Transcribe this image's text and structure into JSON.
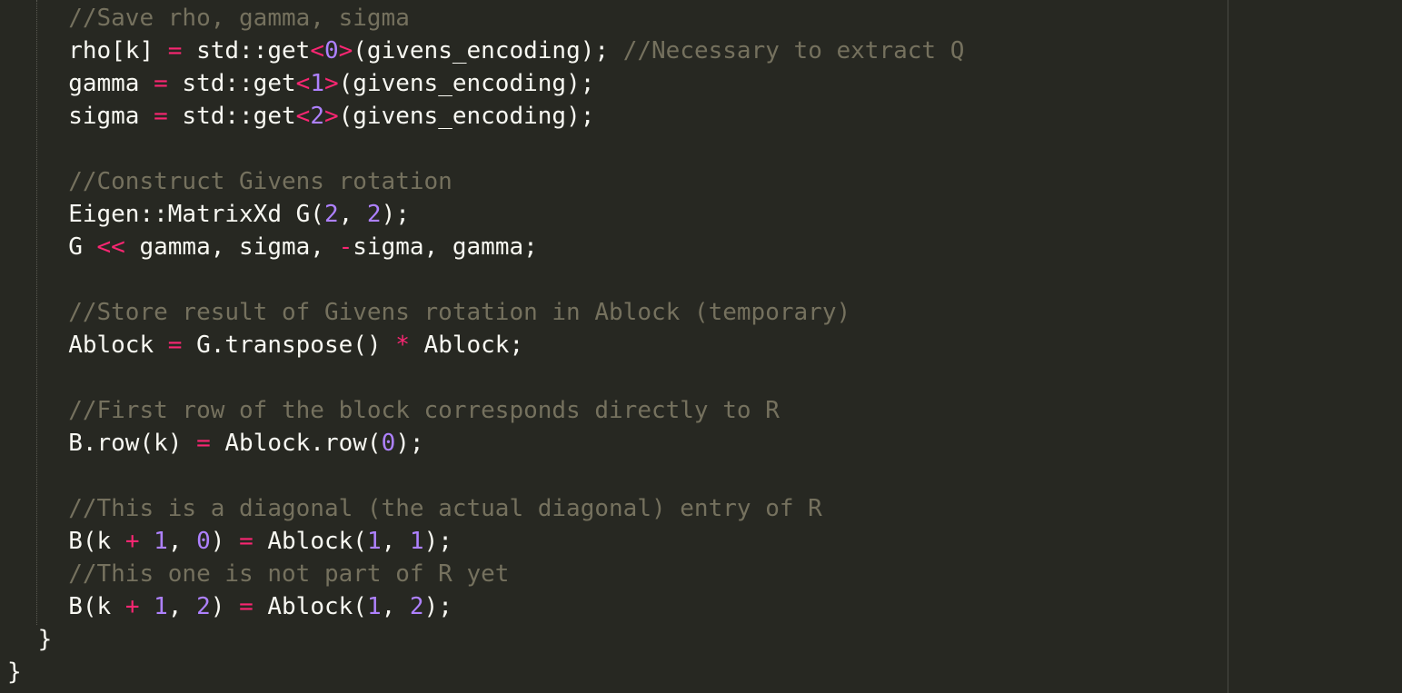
{
  "editor": {
    "colors": {
      "background": "#272822",
      "plain": "#F8F8F2",
      "operator": "#F92672",
      "number": "#AE81FF",
      "comment": "#75715E"
    },
    "lines": [
      {
        "indent": 4,
        "tokens": [
          {
            "k": "com",
            "t": "//Save rho, gamma, sigma"
          }
        ]
      },
      {
        "indent": 4,
        "tokens": [
          {
            "k": "plain",
            "t": "rho[k] "
          },
          {
            "k": "op",
            "t": "="
          },
          {
            "k": "plain",
            "t": " std::get"
          },
          {
            "k": "op",
            "t": "<"
          },
          {
            "k": "num",
            "t": "0"
          },
          {
            "k": "op",
            "t": ">"
          },
          {
            "k": "plain",
            "t": "(givens_encoding); "
          },
          {
            "k": "com",
            "t": "//Necessary to extract Q"
          }
        ]
      },
      {
        "indent": 4,
        "tokens": [
          {
            "k": "plain",
            "t": "gamma "
          },
          {
            "k": "op",
            "t": "="
          },
          {
            "k": "plain",
            "t": " std::get"
          },
          {
            "k": "op",
            "t": "<"
          },
          {
            "k": "num",
            "t": "1"
          },
          {
            "k": "op",
            "t": ">"
          },
          {
            "k": "plain",
            "t": "(givens_encoding);"
          }
        ]
      },
      {
        "indent": 4,
        "tokens": [
          {
            "k": "plain",
            "t": "sigma "
          },
          {
            "k": "op",
            "t": "="
          },
          {
            "k": "plain",
            "t": " std::get"
          },
          {
            "k": "op",
            "t": "<"
          },
          {
            "k": "num",
            "t": "2"
          },
          {
            "k": "op",
            "t": ">"
          },
          {
            "k": "plain",
            "t": "(givens_encoding);"
          }
        ]
      },
      {
        "indent": 0,
        "tokens": []
      },
      {
        "indent": 4,
        "tokens": [
          {
            "k": "com",
            "t": "//Construct Givens rotation"
          }
        ]
      },
      {
        "indent": 4,
        "tokens": [
          {
            "k": "plain",
            "t": "Eigen::MatrixXd G("
          },
          {
            "k": "num",
            "t": "2"
          },
          {
            "k": "plain",
            "t": ", "
          },
          {
            "k": "num",
            "t": "2"
          },
          {
            "k": "plain",
            "t": ");"
          }
        ]
      },
      {
        "indent": 4,
        "tokens": [
          {
            "k": "plain",
            "t": "G "
          },
          {
            "k": "op",
            "t": "<<"
          },
          {
            "k": "plain",
            "t": " gamma, sigma, "
          },
          {
            "k": "op",
            "t": "-"
          },
          {
            "k": "plain",
            "t": "sigma, gamma;"
          }
        ]
      },
      {
        "indent": 0,
        "tokens": []
      },
      {
        "indent": 4,
        "tokens": [
          {
            "k": "com",
            "t": "//Store result of Givens rotation in Ablock (temporary)"
          }
        ]
      },
      {
        "indent": 4,
        "tokens": [
          {
            "k": "plain",
            "t": "Ablock "
          },
          {
            "k": "op",
            "t": "="
          },
          {
            "k": "plain",
            "t": " G.transpose() "
          },
          {
            "k": "op",
            "t": "*"
          },
          {
            "k": "plain",
            "t": " Ablock;"
          }
        ]
      },
      {
        "indent": 0,
        "tokens": []
      },
      {
        "indent": 4,
        "tokens": [
          {
            "k": "com",
            "t": "//First row of the block corresponds directly to R"
          }
        ]
      },
      {
        "indent": 4,
        "tokens": [
          {
            "k": "plain",
            "t": "B.row(k) "
          },
          {
            "k": "op",
            "t": "="
          },
          {
            "k": "plain",
            "t": " Ablock.row("
          },
          {
            "k": "num",
            "t": "0"
          },
          {
            "k": "plain",
            "t": ");"
          }
        ]
      },
      {
        "indent": 0,
        "tokens": []
      },
      {
        "indent": 4,
        "tokens": [
          {
            "k": "com",
            "t": "//This is a diagonal (the actual diagonal) entry of R"
          }
        ]
      },
      {
        "indent": 4,
        "tokens": [
          {
            "k": "plain",
            "t": "B(k "
          },
          {
            "k": "op",
            "t": "+"
          },
          {
            "k": "plain",
            "t": " "
          },
          {
            "k": "num",
            "t": "1"
          },
          {
            "k": "plain",
            "t": ", "
          },
          {
            "k": "num",
            "t": "0"
          },
          {
            "k": "plain",
            "t": ") "
          },
          {
            "k": "op",
            "t": "="
          },
          {
            "k": "plain",
            "t": " Ablock("
          },
          {
            "k": "num",
            "t": "1"
          },
          {
            "k": "plain",
            "t": ", "
          },
          {
            "k": "num",
            "t": "1"
          },
          {
            "k": "plain",
            "t": ");"
          }
        ]
      },
      {
        "indent": 4,
        "tokens": [
          {
            "k": "com",
            "t": "//This one is not part of R yet"
          }
        ]
      },
      {
        "indent": 4,
        "tokens": [
          {
            "k": "plain",
            "t": "B(k "
          },
          {
            "k": "op",
            "t": "+"
          },
          {
            "k": "plain",
            "t": " "
          },
          {
            "k": "num",
            "t": "1"
          },
          {
            "k": "plain",
            "t": ", "
          },
          {
            "k": "num",
            "t": "2"
          },
          {
            "k": "plain",
            "t": ") "
          },
          {
            "k": "op",
            "t": "="
          },
          {
            "k": "plain",
            "t": " Ablock("
          },
          {
            "k": "num",
            "t": "1"
          },
          {
            "k": "plain",
            "t": ", "
          },
          {
            "k": "num",
            "t": "2"
          },
          {
            "k": "plain",
            "t": ");"
          }
        ]
      },
      {
        "indent": 2,
        "tokens": [
          {
            "k": "plain",
            "t": "}"
          }
        ]
      },
      {
        "indent": 0,
        "tokens": [
          {
            "k": "plain",
            "t": "}"
          }
        ]
      }
    ]
  }
}
